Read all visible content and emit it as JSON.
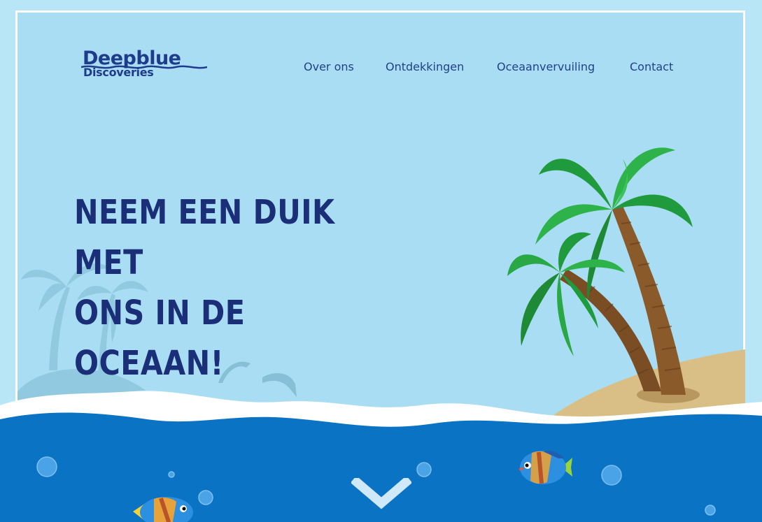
{
  "brand": {
    "line1": "Deepblue",
    "line2": "Discoveries"
  },
  "nav": {
    "items": [
      {
        "label": "Over ons"
      },
      {
        "label": "Ontdekkingen"
      },
      {
        "label": "Oceaanvervuiling"
      },
      {
        "label": "Contact"
      }
    ]
  },
  "hero": {
    "line1": "NEEM EEN DUIK MET",
    "line2": "ONS IN DE OCEAAN!"
  },
  "icons": {
    "scroll": "chevron-down-icon"
  },
  "colors": {
    "sky": "#a9ddf3",
    "ocean": "#0b73c4",
    "sand": "#d9bf86",
    "title": "#1b2f78",
    "nav": "#233f8c"
  }
}
